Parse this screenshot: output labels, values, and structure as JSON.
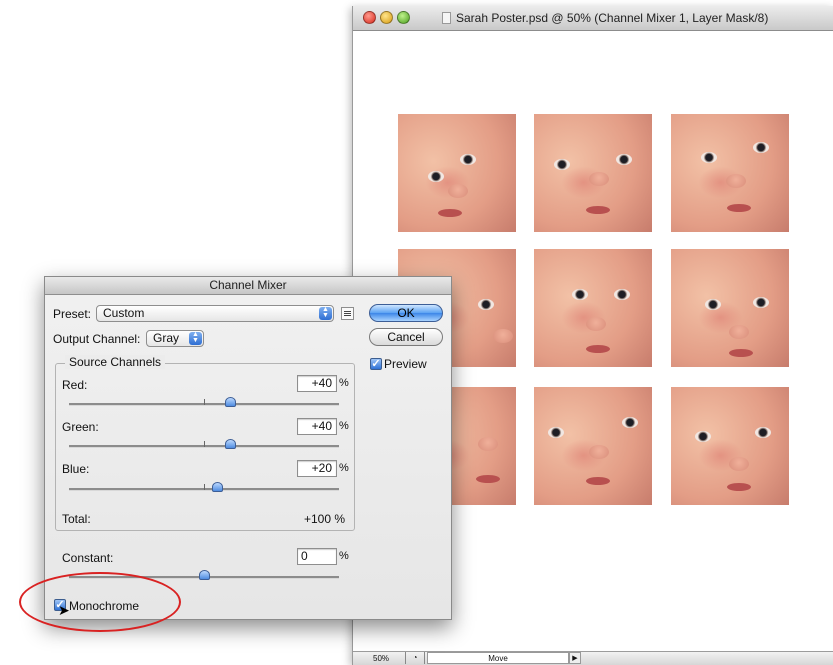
{
  "document": {
    "title": "Sarah Poster.psd @ 50% (Channel Mixer 1, Layer Mask/8)",
    "status_zoom": "50%",
    "status_info": "Move"
  },
  "dialog": {
    "title": "Channel Mixer",
    "preset_label": "Preset:",
    "preset_value": "Custom",
    "output_label": "Output Channel:",
    "output_value": "Gray",
    "ok_label": "OK",
    "cancel_label": "Cancel",
    "preview_label": "Preview",
    "preview_checked": true,
    "source_group_label": "Source Channels",
    "red_label": "Red:",
    "red_value": "+40",
    "green_label": "Green:",
    "green_value": "+40",
    "blue_label": "Blue:",
    "blue_value": "+20",
    "percent": "%",
    "total_label": "Total:",
    "total_value": "+100 %",
    "constant_label": "Constant:",
    "constant_value": "0",
    "monochrome_label": "Monochrome",
    "monochrome_checked": true
  },
  "colors": {
    "annotation_circle": "#d92222",
    "button_accent": "#3c86e8"
  }
}
